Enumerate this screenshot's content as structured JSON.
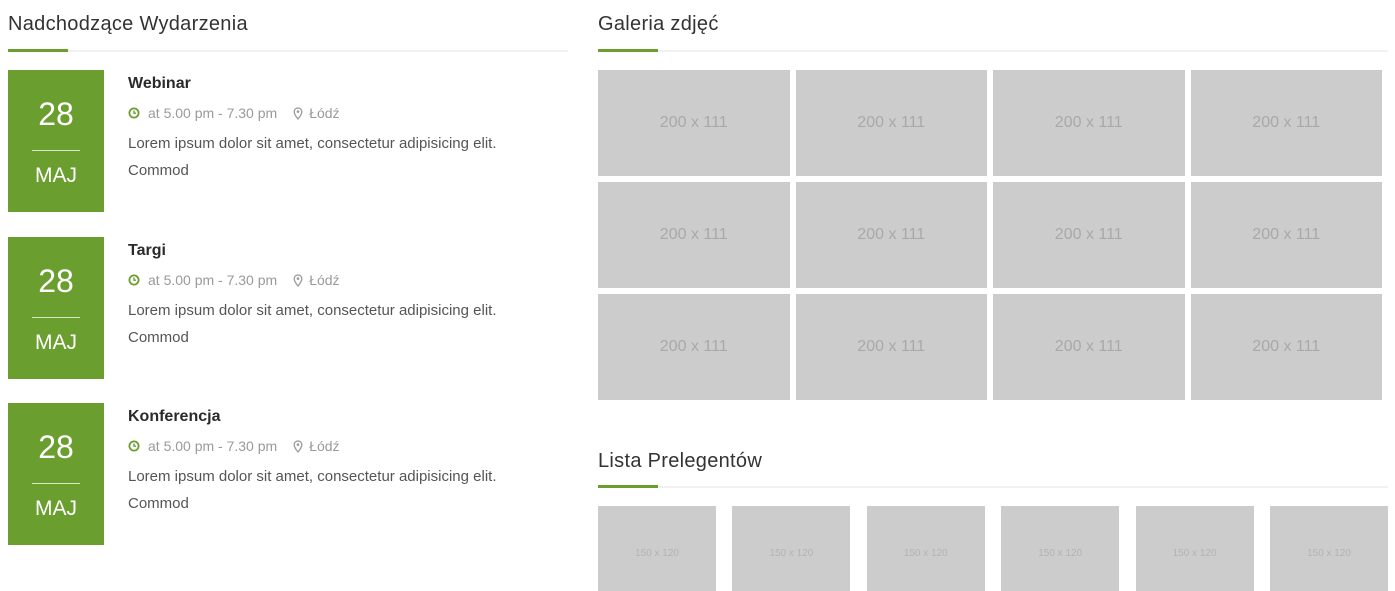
{
  "events": {
    "title": "Nadchodzące Wydarzenia",
    "accent_color": "#6a9f2f",
    "items": [
      {
        "day": "28",
        "month": "MAJ",
        "title": "Webinar",
        "time": "at 5.00 pm - 7.30 pm",
        "location": "Łódź",
        "description": "Lorem ipsum dolor sit amet, consectetur adipisicing elit. Commod"
      },
      {
        "day": "28",
        "month": "MAJ",
        "title": "Targi",
        "time": "at 5.00 pm - 7.30 pm",
        "location": "Łódź",
        "description": "Lorem ipsum dolor sit amet, consectetur adipisicing elit. Commod"
      },
      {
        "day": "28",
        "month": "MAJ",
        "title": "Konferencja",
        "time": "at 5.00 pm - 7.30 pm",
        "location": "Łódź",
        "description": "Lorem ipsum dolor sit amet, consectetur adipisicing elit. Commod"
      }
    ]
  },
  "gallery": {
    "title": "Galeria zdjęć",
    "thumbs": [
      "200 x 111",
      "200 x 111",
      "200 x 111",
      "200 x 111",
      "200 x 111",
      "200 x 111",
      "200 x 111",
      "200 x 111",
      "200 x 111",
      "200 x 111",
      "200 x 111",
      "200 x 111"
    ]
  },
  "speakers": {
    "title": "Lista Prelegentów",
    "thumbs": [
      "150 x 120",
      "150 x 120",
      "150 x 120",
      "150 x 120",
      "150 x 120",
      "150 x 120"
    ]
  },
  "icons": {
    "time": "clock-icon",
    "location": "map-pin-icon"
  }
}
